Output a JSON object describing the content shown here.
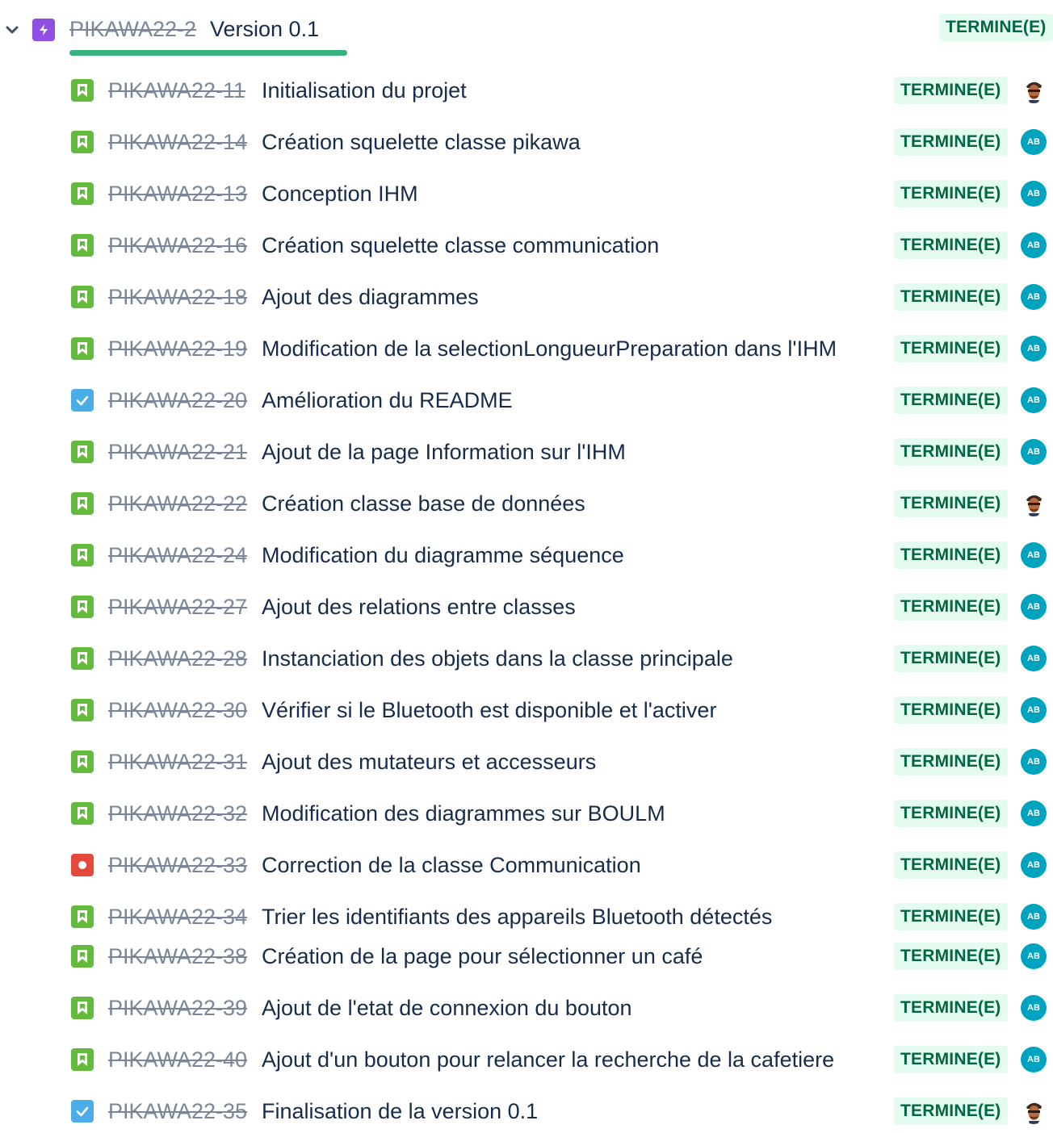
{
  "epic": {
    "key": "PIKAWA22-2",
    "title": "Version 0.1",
    "status": "TERMINE(E)",
    "progress": 1.0,
    "icon": "epic-icon",
    "color": "#904ee2"
  },
  "status_colors": {
    "done_bg": "#e3fcef",
    "done_text": "#006644"
  },
  "issues": [
    {
      "type": "story",
      "key": "PIKAWA22-11",
      "summary": "Initialisation du projet",
      "status": "TERMINE(E)",
      "assignee": "photo"
    },
    {
      "type": "story",
      "key": "PIKAWA22-14",
      "summary": "Création squelette classe pikawa",
      "status": "TERMINE(E)",
      "assignee": "AB"
    },
    {
      "type": "story",
      "key": "PIKAWA22-13",
      "summary": "Conception IHM",
      "status": "TERMINE(E)",
      "assignee": "AB"
    },
    {
      "type": "story",
      "key": "PIKAWA22-16",
      "summary": "Création squelette classe communication",
      "status": "TERMINE(E)",
      "assignee": "AB"
    },
    {
      "type": "story",
      "key": "PIKAWA22-18",
      "summary": "Ajout des diagrammes",
      "status": "TERMINE(E)",
      "assignee": "AB"
    },
    {
      "type": "story",
      "key": "PIKAWA22-19",
      "summary": "Modification de la selectionLongueurPreparation dans l'IHM",
      "status": "TERMINE(E)",
      "assignee": "AB"
    },
    {
      "type": "task",
      "key": "PIKAWA22-20",
      "summary": "Amélioration du README",
      "status": "TERMINE(E)",
      "assignee": "AB"
    },
    {
      "type": "story",
      "key": "PIKAWA22-21",
      "summary": "Ajout de la page Information sur l'IHM",
      "status": "TERMINE(E)",
      "assignee": "AB"
    },
    {
      "type": "story",
      "key": "PIKAWA22-22",
      "summary": "Création classe base de données",
      "status": "TERMINE(E)",
      "assignee": "photo"
    },
    {
      "type": "story",
      "key": "PIKAWA22-24",
      "summary": "Modification du diagramme séquence",
      "status": "TERMINE(E)",
      "assignee": "AB"
    },
    {
      "type": "story",
      "key": "PIKAWA22-27",
      "summary": "Ajout des relations entre classes",
      "status": "TERMINE(E)",
      "assignee": "AB"
    },
    {
      "type": "story",
      "key": "PIKAWA22-28",
      "summary": "Instanciation des objets dans la classe principale",
      "status": "TERMINE(E)",
      "assignee": "AB"
    },
    {
      "type": "story",
      "key": "PIKAWA22-30",
      "summary": "Vérifier si le Bluetooth est disponible et l'activer",
      "status": "TERMINE(E)",
      "assignee": "AB"
    },
    {
      "type": "story",
      "key": "PIKAWA22-31",
      "summary": "Ajout des mutateurs et accesseurs",
      "status": "TERMINE(E)",
      "assignee": "AB"
    },
    {
      "type": "story",
      "key": "PIKAWA22-32",
      "summary": "Modification des diagrammes sur BOULM",
      "status": "TERMINE(E)",
      "assignee": "AB"
    },
    {
      "type": "bug",
      "key": "PIKAWA22-33",
      "summary": "Correction de la classe Communication",
      "status": "TERMINE(E)",
      "assignee": "AB"
    },
    {
      "type": "story",
      "key": "PIKAWA22-34",
      "summary": "Trier les identifiants des appareils Bluetooth détectés",
      "status": "TERMINE(E)",
      "assignee": "AB"
    },
    {
      "type": "story",
      "key": "PIKAWA22-38",
      "summary": "Création de la page pour sélectionner un café",
      "status": "TERMINE(E)",
      "assignee": "AB"
    },
    {
      "type": "story",
      "key": "PIKAWA22-39",
      "summary": "Ajout de l'etat de connexion du bouton",
      "status": "TERMINE(E)",
      "assignee": "AB"
    },
    {
      "type": "story",
      "key": "PIKAWA22-40",
      "summary": "Ajout d'un bouton pour relancer la recherche de la cafetiere",
      "status": "TERMINE(E)",
      "assignee": "AB"
    },
    {
      "type": "task",
      "key": "PIKAWA22-35",
      "summary": "Finalisation de la version 0.1",
      "status": "TERMINE(E)",
      "assignee": "photo"
    }
  ]
}
